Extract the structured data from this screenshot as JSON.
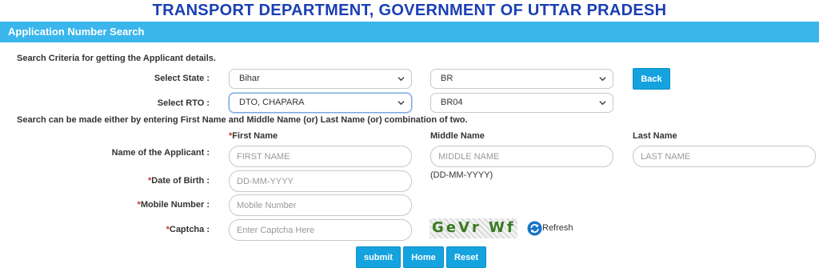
{
  "header": {
    "department_title": "TRANSPORT DEPARTMENT, GOVERNMENT OF UTTAR PRADESH",
    "panel_title": "Application Number Search",
    "accent_color": "#3ab6ec"
  },
  "form": {
    "criteria_text": "Search Criteria for getting the Applicant details.",
    "state_label": "Select State :",
    "state_value": "Bihar",
    "state_code_value": "BR",
    "back_button": "Back",
    "rto_label": "Select RTO :",
    "rto_value": "DTO, CHAPARA",
    "rto_code_value": "BR04",
    "name_info_text": "Search can be made either by entering First Name and Middle Name (or) Last Name (or) combination of two.",
    "required_mark": "*",
    "first_name_header": "First Name",
    "middle_name_header": "Middle Name",
    "last_name_header": "Last Name",
    "applicant_name_label": "Name of the Applicant :",
    "first_name_placeholder": "FIRST NAME",
    "middle_name_placeholder": "MIDDLE NAME",
    "last_name_placeholder": "LAST NAME",
    "dob_label": "Date of Birth :",
    "dob_placeholder": "DD-MM-YYYY",
    "dob_hint": "(DD-MM-YYYY)",
    "mobile_label": "Mobile Number :",
    "mobile_placeholder": "Mobile Number",
    "captcha_label": "Captcha :",
    "captcha_placeholder": "Enter Captcha Here",
    "captcha_text": "GeVr Wf",
    "refresh_label": "Refresh"
  },
  "actions": {
    "submit": "submit",
    "home": "Home",
    "reset": "Reset"
  }
}
